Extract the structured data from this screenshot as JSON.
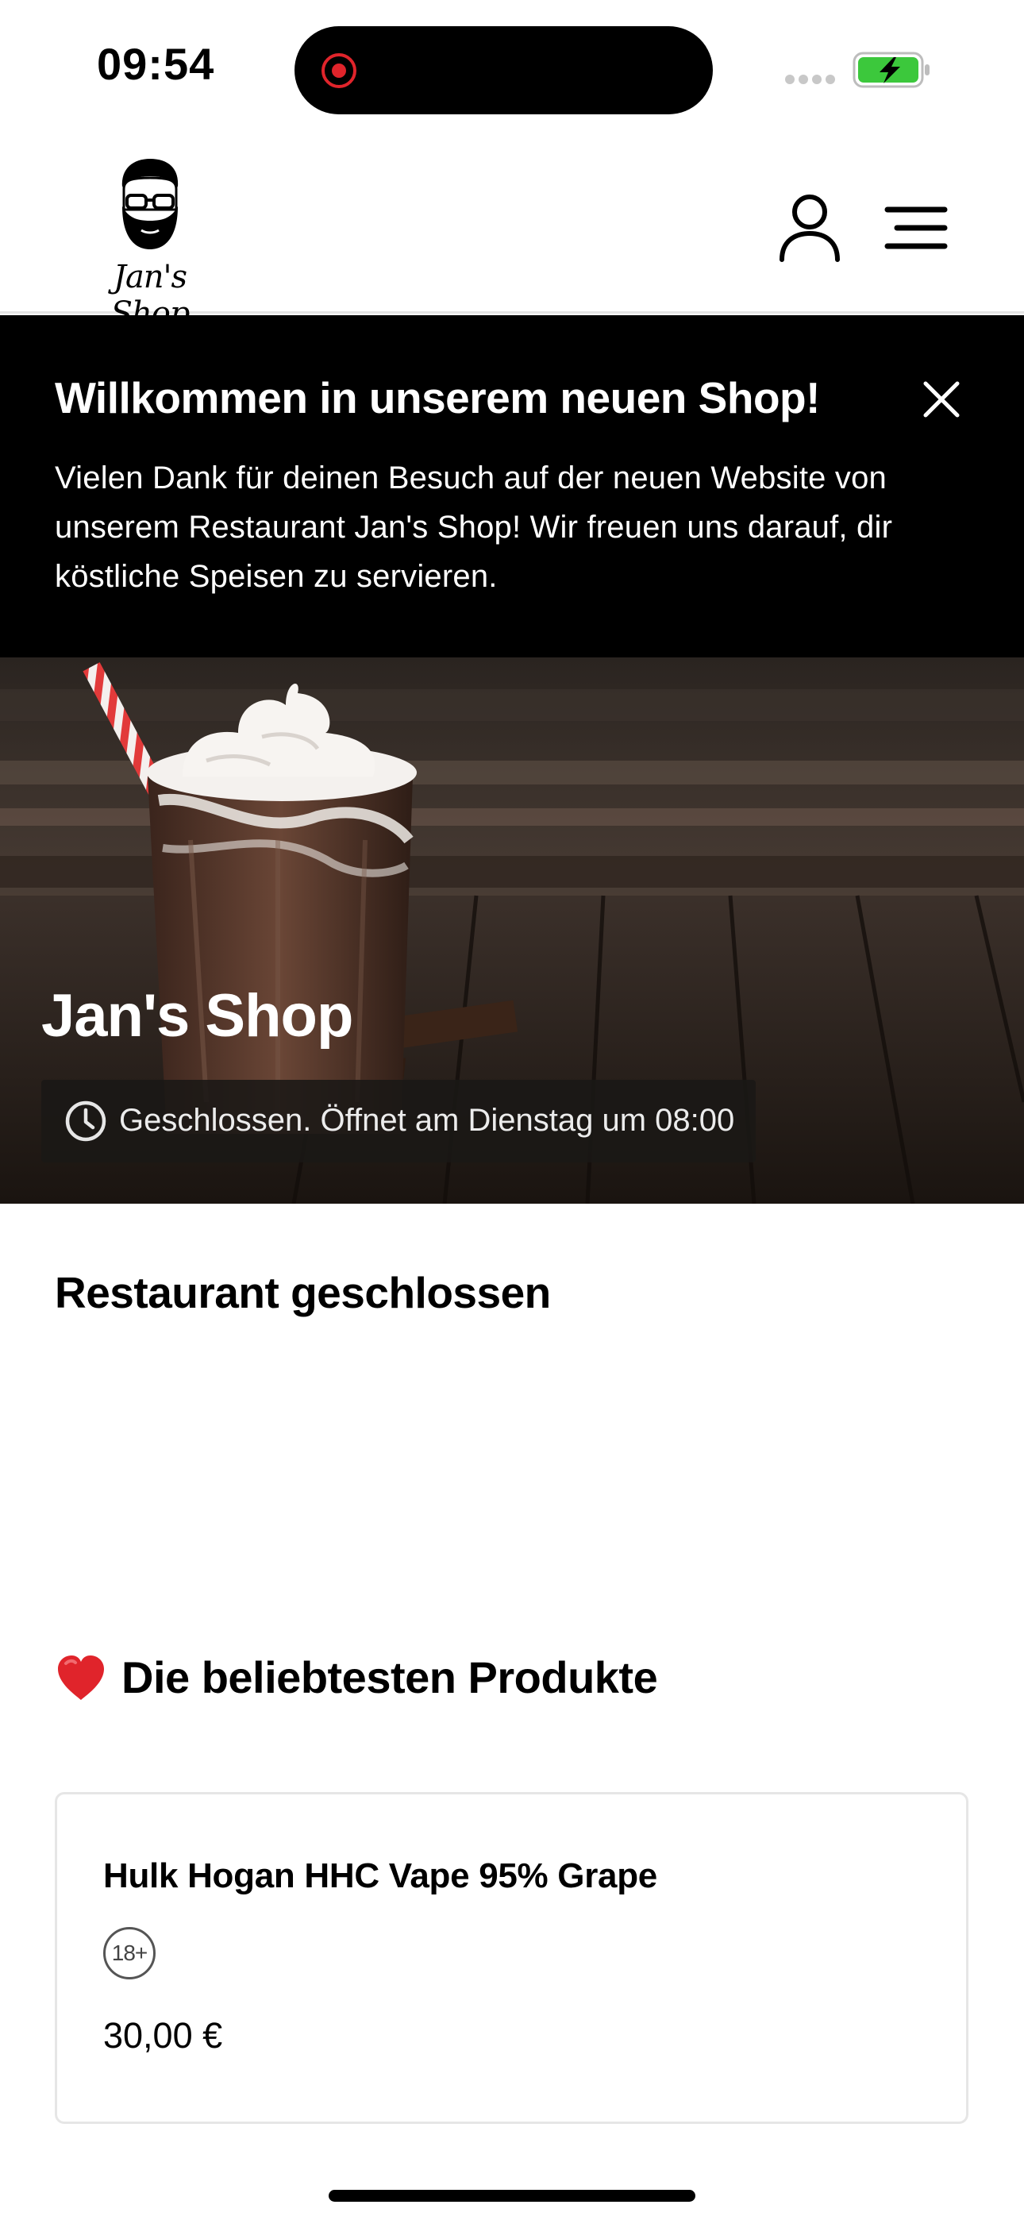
{
  "status_bar": {
    "time": "09:54",
    "battery_color": "#3cc83c"
  },
  "header": {
    "logo_text": "Jan's Shop",
    "account_icon": "user-icon",
    "menu_icon": "hamburger-menu-icon"
  },
  "welcome": {
    "title": "Willkommen in unserem neuen Shop!",
    "text": "Vielen Dank für deinen Besuch auf der neuen Website von unserem Restaurant Jan's Shop! Wir freuen uns darauf, dir köstliche Speisen zu servieren.",
    "close_icon": "close-icon"
  },
  "hero": {
    "title": "Jan's Shop",
    "hours_text": "Geschlossen. Öffnet am Dienstag um 08:00",
    "hours_icon": "clock-icon"
  },
  "closed_section": {
    "heading": "Restaurant geschlossen"
  },
  "popular": {
    "heading": "Die beliebtesten Produkte",
    "heading_icon": "heart-icon",
    "products": [
      {
        "name": "Hulk Hogan HHC Vape 95% Grape",
        "age_badge": "18+",
        "price": "30,00 €"
      }
    ]
  },
  "colors": {
    "accent_red": "#e0242b",
    "banner_bg": "#000000",
    "card_border": "#e6e6e6"
  }
}
